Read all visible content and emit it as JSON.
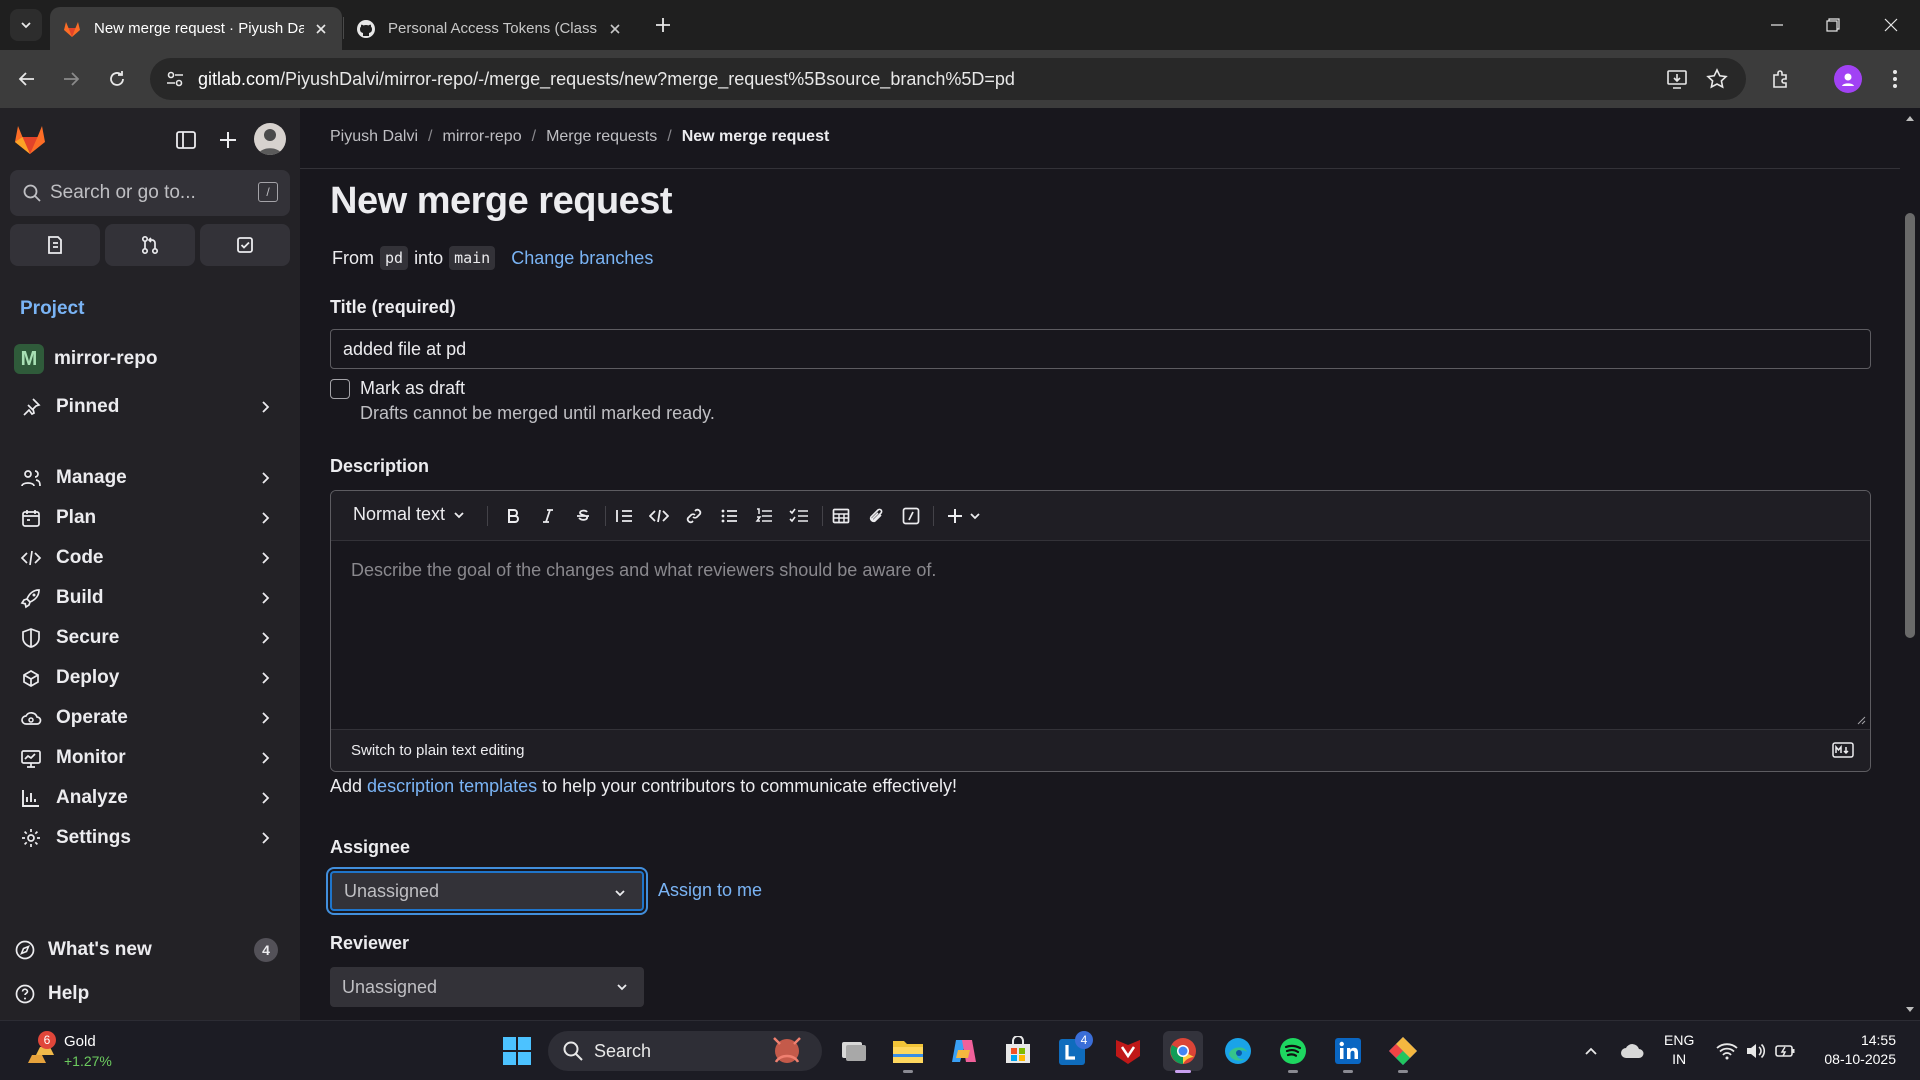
{
  "browser": {
    "tabs": [
      {
        "title": "New merge request · Piyush Dalvi / mirror-repo",
        "active": true
      },
      {
        "title": "Personal Access Tokens (Classic)",
        "active": false
      }
    ],
    "url_host": "gitlab.com",
    "url_path": "/PiyushDalvi/mirror-repo/-/merge_requests/new?merge_request%5Bsource_branch%5D=pd"
  },
  "sidebar": {
    "search_placeholder": "Search or go to...",
    "search_shortcut": "/",
    "section_label": "Project",
    "project_badge": "M",
    "project_name": "mirror-repo",
    "pinned_label": "Pinned",
    "items": [
      {
        "label": "Manage",
        "icon": "users-icon"
      },
      {
        "label": "Plan",
        "icon": "calendar-icon"
      },
      {
        "label": "Code",
        "icon": "code-icon"
      },
      {
        "label": "Build",
        "icon": "rocket-icon"
      },
      {
        "label": "Secure",
        "icon": "shield-icon"
      },
      {
        "label": "Deploy",
        "icon": "deploy-icon"
      },
      {
        "label": "Operate",
        "icon": "cloud-gear-icon"
      },
      {
        "label": "Monitor",
        "icon": "monitor-icon"
      },
      {
        "label": "Analyze",
        "icon": "chart-icon"
      },
      {
        "label": "Settings",
        "icon": "gear-icon"
      }
    ],
    "whats_new_label": "What's new",
    "whats_new_count": "4",
    "help_label": "Help"
  },
  "breadcrumb": {
    "items": [
      "Piyush Dalvi",
      "mirror-repo",
      "Merge requests"
    ],
    "current": "New merge request"
  },
  "page": {
    "title": "New merge request",
    "from_label": "From",
    "source_branch": "pd",
    "into_label": "into",
    "target_branch": "main",
    "change_branches": "Change branches",
    "title_label": "Title (required)",
    "title_value": "added file at pd",
    "draft_label": "Mark as draft",
    "draft_help": "Drafts cannot be merged until marked ready.",
    "description_label": "Description",
    "editor_format": "Normal text",
    "editor_placeholder": "Describe the goal of the changes and what reviewers should be aware of.",
    "plain_text_switch": "Switch to plain text editing",
    "templates_prefix": "Add",
    "templates_link": "description templates",
    "templates_suffix": "to help your contributors to communicate effectively!",
    "assignee_label": "Assignee",
    "assignee_value": "Unassigned",
    "assign_to_me": "Assign to me",
    "reviewer_label": "Reviewer",
    "reviewer_value": "Unassigned"
  },
  "taskbar": {
    "weather_badge": "6",
    "weather_title": "Gold",
    "weather_change": "+1.27%",
    "search_label": "Search",
    "outlook_badge": "4",
    "lang_top": "ENG",
    "lang_bottom": "IN",
    "time": "14:55",
    "date": "08-10-2025"
  },
  "colors": {
    "link": "#7ab4f5",
    "background": "#18171d",
    "sidebar": "#232226",
    "focus": "#428fdc"
  }
}
